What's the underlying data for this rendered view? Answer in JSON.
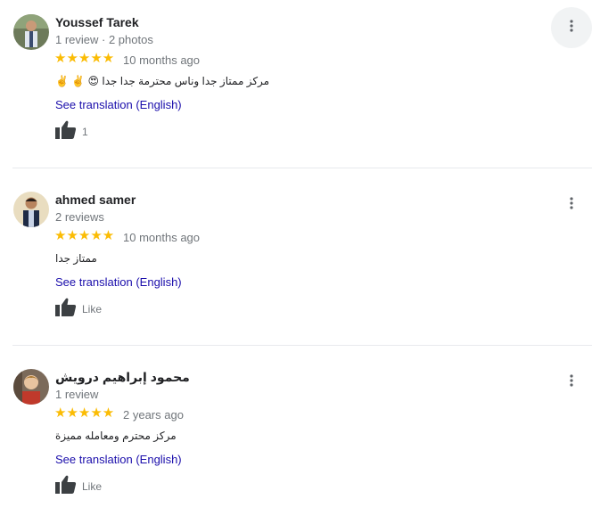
{
  "reviews": [
    {
      "name": "Youssef Tarek",
      "meta": "1 review · 2 photos",
      "stars": "★★★★★",
      "rating": 5,
      "date": "10 months ago",
      "text": "مركز ممتاز جدا وناس محترمة جدا جدا 😍 ✌️ ✌️",
      "translate": "See translation (English)",
      "like": "1"
    },
    {
      "name": "ahmed samer",
      "meta": "2 reviews",
      "stars": "★★★★★",
      "rating": 5,
      "date": "10 months ago",
      "text": "ممتاز جدا",
      "translate": "See translation (English)",
      "like": "Like"
    },
    {
      "name": "محمود إبراهيم درويش",
      "meta": "1 review",
      "stars": "★★★★★",
      "rating": 5,
      "date": "2 years ago",
      "text": "مركز محترم ومعامله مميزة",
      "translate": "See translation (English)",
      "like": "Like"
    }
  ],
  "colors": {
    "star": "#fbbc04",
    "link": "#1a0dab",
    "muted": "#70757a"
  },
  "icons": {
    "like": "thumbs-up-icon",
    "more": "more-vert-icon"
  }
}
